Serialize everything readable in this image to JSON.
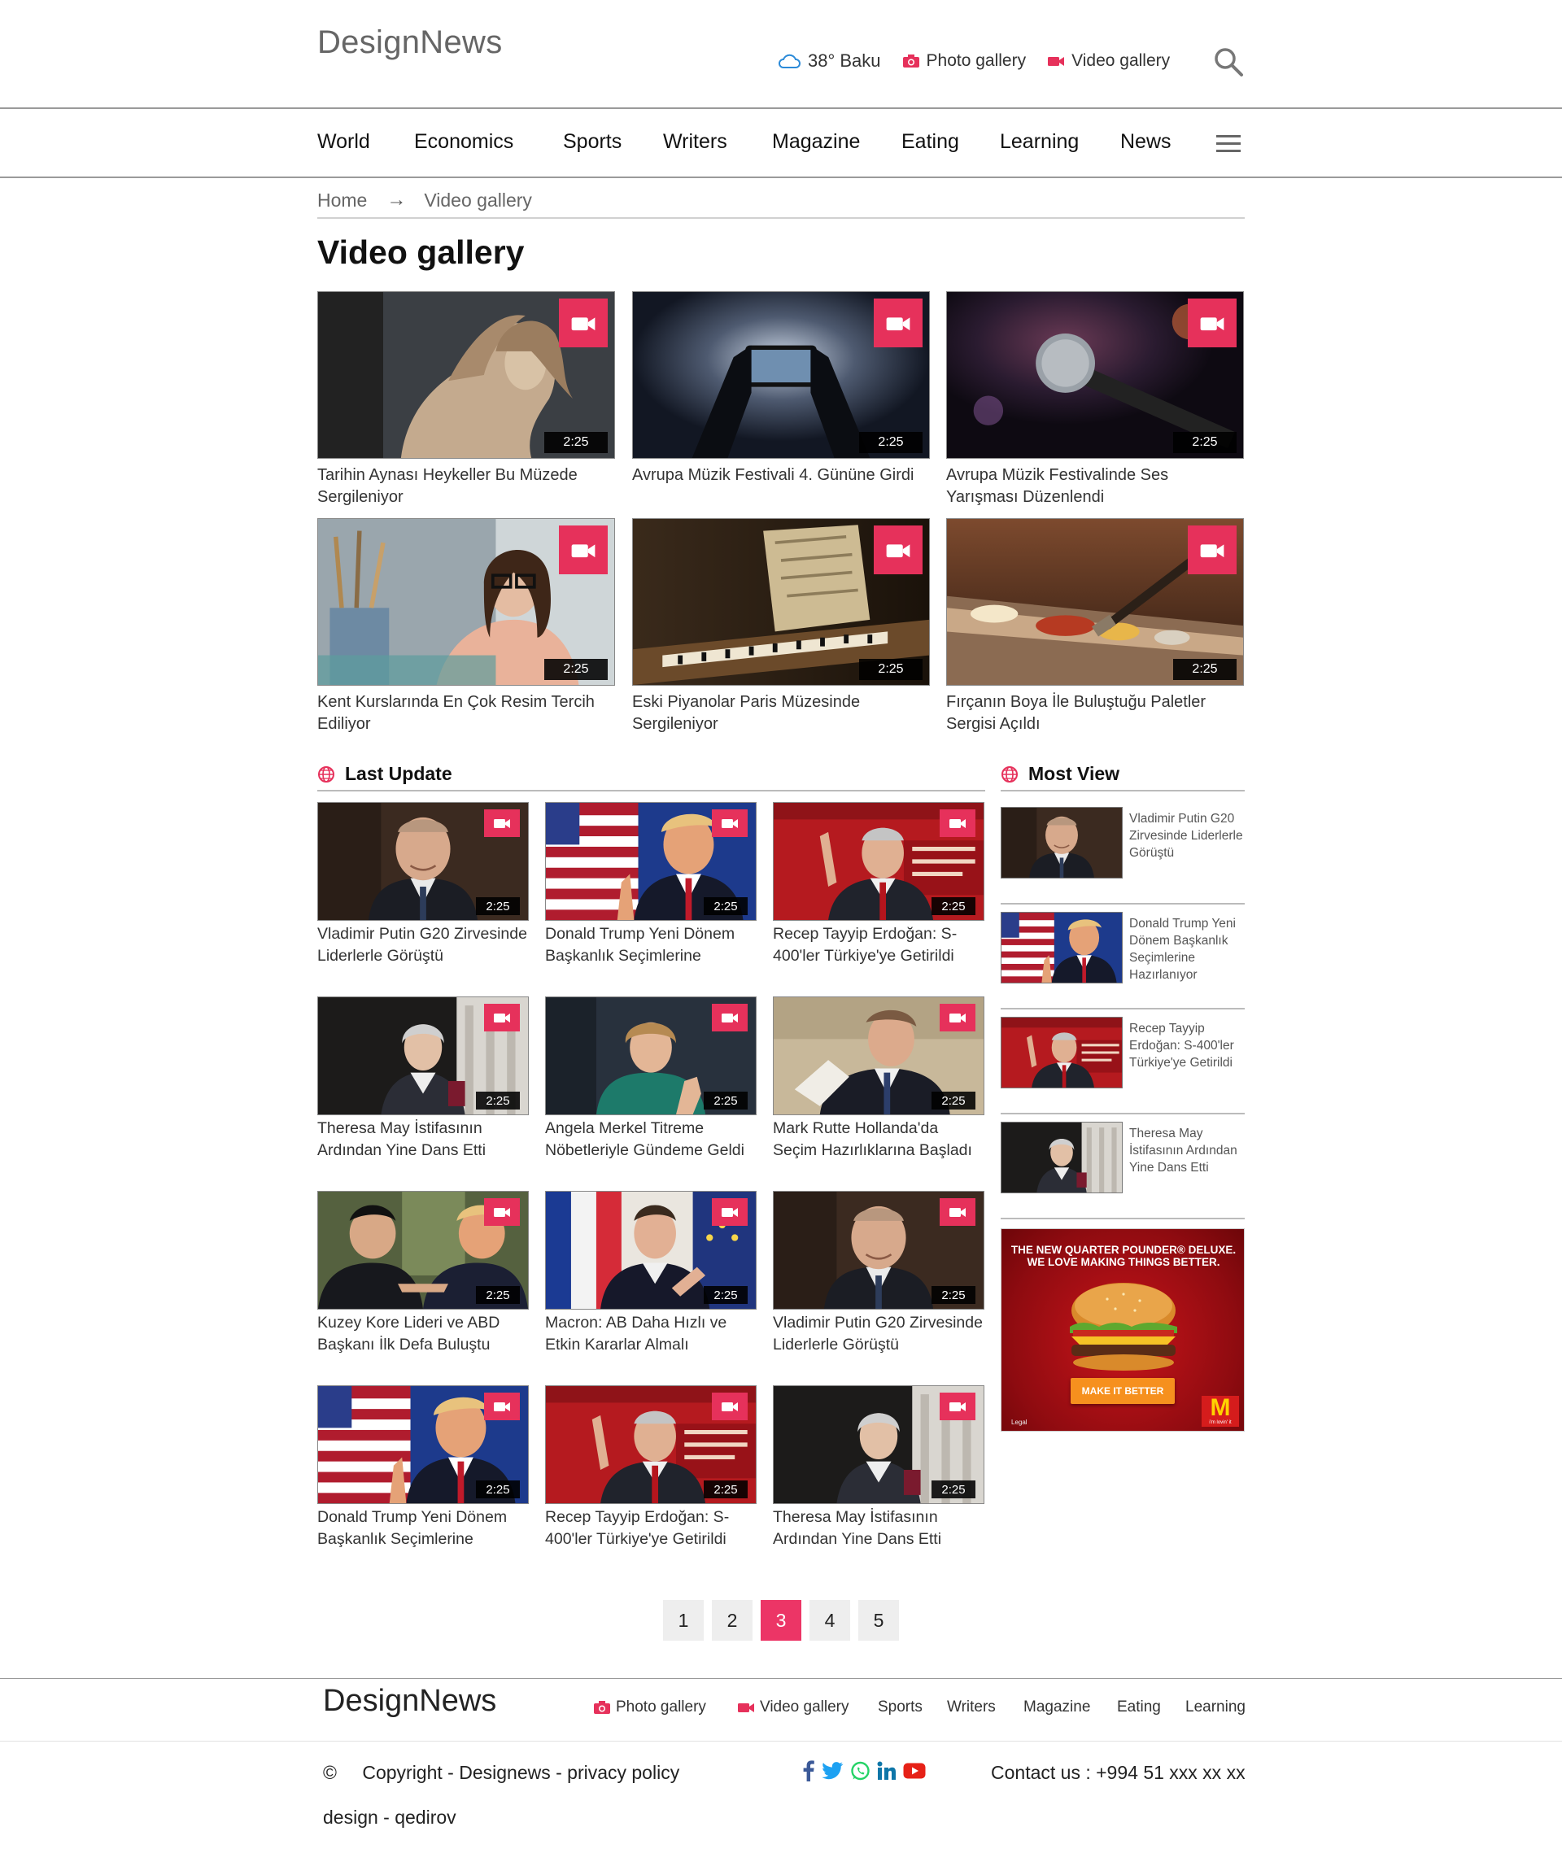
{
  "header": {
    "logo": "DesignNews",
    "weather": "38° Baku",
    "photo_gallery": "Photo gallery",
    "video_gallery": "Video gallery"
  },
  "nav": [
    "World",
    "Economics",
    "Sports",
    "Writers",
    "Magazine",
    "Eating",
    "Learning",
    "News"
  ],
  "breadcrumb": {
    "home": "Home",
    "current": "Video gallery"
  },
  "page_title": "Video gallery",
  "gallery": [
    {
      "caption": "Tarihin Aynası Heykeller Bu Müzede Sergileniyor",
      "duration": "2:25",
      "image": "marble-statue"
    },
    {
      "caption": "Avrupa Müzik Festivali 4. Gününe Girdi",
      "duration": "2:25",
      "image": "phone-concert"
    },
    {
      "caption": "Avrupa Müzik Festivalinde Ses Yarışması Düzenlendi",
      "duration": "2:25",
      "image": "microphone"
    },
    {
      "caption": "Kent Kurslarında En Çok Resim Tercih Ediliyor",
      "duration": "2:25",
      "image": "painter-woman"
    },
    {
      "caption": "Eski Piyanolar Paris Müzesinde Sergileniyor",
      "duration": "2:25",
      "image": "old-piano"
    },
    {
      "caption": "Fırçanın Boya İle Buluştuğu Paletler Sergisi Açıldı",
      "duration": "2:25",
      "image": "paint-palette"
    }
  ],
  "last_update": {
    "title": "Last Update",
    "items": [
      {
        "caption": "Vladimir Putin G20 Zirvesinde Liderlerle Görüştü",
        "duration": "2:25",
        "image": "putin"
      },
      {
        "caption": "Donald Trump Yeni Dönem Başkanlık Seçimlerine",
        "duration": "2:25",
        "image": "trump"
      },
      {
        "caption": "Recep Tayyip Erdoğan: S-400'ler Türkiye'ye Getirildi",
        "duration": "2:25",
        "image": "erdogan"
      },
      {
        "caption": "Theresa May İstifasının Ardından Yine Dans Etti",
        "duration": "2:25",
        "image": "may"
      },
      {
        "caption": "Angela Merkel Titreme Nöbetleriyle Gündeme Geldi",
        "duration": "2:25",
        "image": "merkel"
      },
      {
        "caption": "Mark Rutte Hollanda'da Seçim Hazırlıklarına Başladı",
        "duration": "2:25",
        "image": "rutte"
      },
      {
        "caption": "Kuzey Kore Lideri ve ABD Başkanı İlk Defa Buluştu",
        "duration": "2:25",
        "image": "kim-trump"
      },
      {
        "caption": "Macron: AB Daha Hızlı ve Etkin Kararlar Almalı",
        "duration": "2:25",
        "image": "macron"
      },
      {
        "caption": "Vladimir Putin G20 Zirvesinde Liderlerle Görüştü",
        "duration": "2:25",
        "image": "putin"
      },
      {
        "caption": "Donald Trump Yeni Dönem Başkanlık Seçimlerine",
        "duration": "2:25",
        "image": "trump"
      },
      {
        "caption": "Recep Tayyip Erdoğan: S-400'ler Türkiye'ye Getirildi",
        "duration": "2:25",
        "image": "erdogan"
      },
      {
        "caption": "Theresa May İstifasının Ardından Yine Dans Etti",
        "duration": "2:25",
        "image": "may"
      }
    ]
  },
  "most_view": {
    "title": "Most View",
    "items": [
      {
        "caption": "Vladimir Putin G20 Zirvesinde Liderlerle Görüştü",
        "image": "putin"
      },
      {
        "caption": "Donald Trump Yeni Dönem Başkanlık Seçimlerine Hazırlanıyor",
        "image": "trump"
      },
      {
        "caption": "Recep Tayyip Erdoğan: S-400'ler Türkiye'ye Getirildi",
        "image": "erdogan"
      },
      {
        "caption": "Theresa May İstifasının Ardından Yine Dans Etti",
        "image": "may"
      }
    ]
  },
  "ad": {
    "headline_1": "THE NEW QUARTER POUNDER® DELUXE.",
    "headline_2": "WE LOVE MAKING THINGS BETTER.",
    "button": "MAKE IT BETTER",
    "logo": "M",
    "slogan": "i'm lovin' it",
    "legal": "Legal"
  },
  "pagination": {
    "pages": [
      "1",
      "2",
      "3",
      "4",
      "5"
    ],
    "active": "3"
  },
  "footer": {
    "logo": "DesignNews",
    "links": [
      "Photo gallery",
      "Video gallery",
      "Sports",
      "Writers",
      "Magazine",
      "Eating",
      "Learning"
    ],
    "copyright_symbol": "©",
    "copyright": "Copyright - Designews - privacy policy",
    "design": "design - qedirov",
    "contact": "Contact us : +994 51 xxx xx xx",
    "socials": [
      "facebook-icon",
      "twitter-icon",
      "whatsapp-icon",
      "linkedin-icon",
      "youtube-icon"
    ]
  },
  "colors": {
    "accent": "#e6315b",
    "active_page": "#ec3566",
    "footer_icon": "#e6315b",
    "ad_red": "#c8141a"
  }
}
